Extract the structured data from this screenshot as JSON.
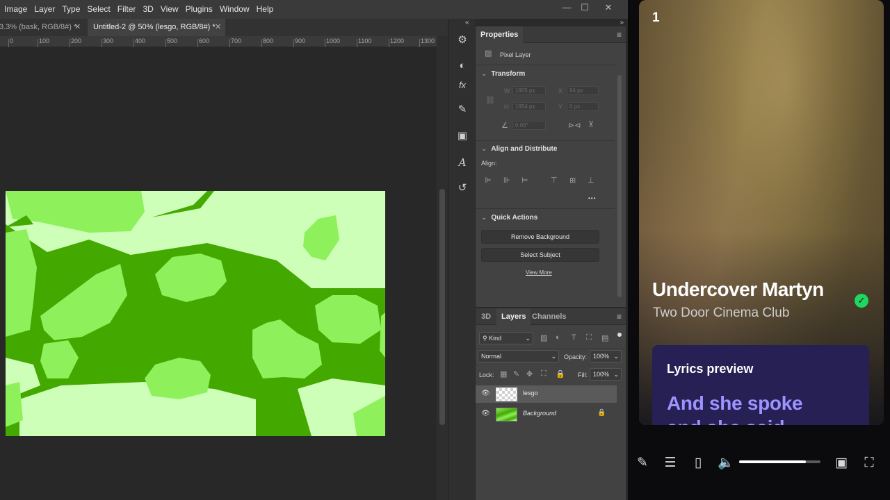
{
  "photoshop": {
    "menu": [
      "Image",
      "Layer",
      "Type",
      "Select",
      "Filter",
      "3D",
      "View",
      "Plugins",
      "Window",
      "Help"
    ],
    "window_controls": {
      "minimize": "—",
      "restore": "☐",
      "close": "✕"
    },
    "tabs": [
      {
        "label": "3.3% (bask, RGB/8#) *",
        "active": false
      },
      {
        "label": "Untitled-2 @ 50% (lesgo, RGB/8#) *",
        "active": true
      }
    ],
    "ruler": [
      "0",
      "100",
      "200",
      "300",
      "400",
      "500",
      "600",
      "700",
      "800",
      "900",
      "1000",
      "1100",
      "1200",
      "1300"
    ],
    "properties": {
      "tab": "Properties",
      "layer_type": "Pixel Layer",
      "transform": {
        "title": "Transform",
        "w_label": "W",
        "w_value": "1905 px",
        "x_label": "X",
        "x_value": "94 px",
        "h_label": "H",
        "h_value": "1954 px",
        "y_label": "Y",
        "y_value": "0 px",
        "angle_value": "0.00°"
      },
      "align": {
        "title": "Align and Distribute",
        "label": "Align:",
        "more": "•••"
      },
      "quick_actions": {
        "title": "Quick Actions",
        "remove_bg": "Remove Background",
        "select_subject": "Select Subject",
        "view_more": "View More"
      }
    },
    "layers_panel": {
      "tabs": [
        "3D",
        "Layers",
        "Channels"
      ],
      "active_tab": "Layers",
      "filter_kind": "Kind",
      "blend_mode": "Normal",
      "opacity_label": "Opacity:",
      "opacity_value": "100%",
      "lock_label": "Lock:",
      "fill_label": "Fill:",
      "fill_value": "100%",
      "layers": [
        {
          "name": "lesgo",
          "selected": true,
          "locked": false
        },
        {
          "name": "Background",
          "selected": false,
          "locked": true
        }
      ]
    },
    "canvas_colors": {
      "dark_green": "#43a800",
      "mid_green": "#8ef05a",
      "light_green": "#ceffb8"
    }
  },
  "player": {
    "track_index": "1",
    "title": "Undercover Martyn",
    "artist": "Two Door Cinema Club",
    "verified_icon": "check-icon",
    "lyrics": {
      "title": "Lyrics preview",
      "line": "And she spoke",
      "line2": "and she said"
    },
    "controls": [
      "microphone-icon",
      "queue-icon",
      "device-icon",
      "volume-icon",
      "miniplayer-icon",
      "fullscreen-icon"
    ],
    "volume": 0.82,
    "accent": "#1ed760",
    "lyrics_bg": "#262055",
    "lyrics_color": "#9e93ff"
  }
}
